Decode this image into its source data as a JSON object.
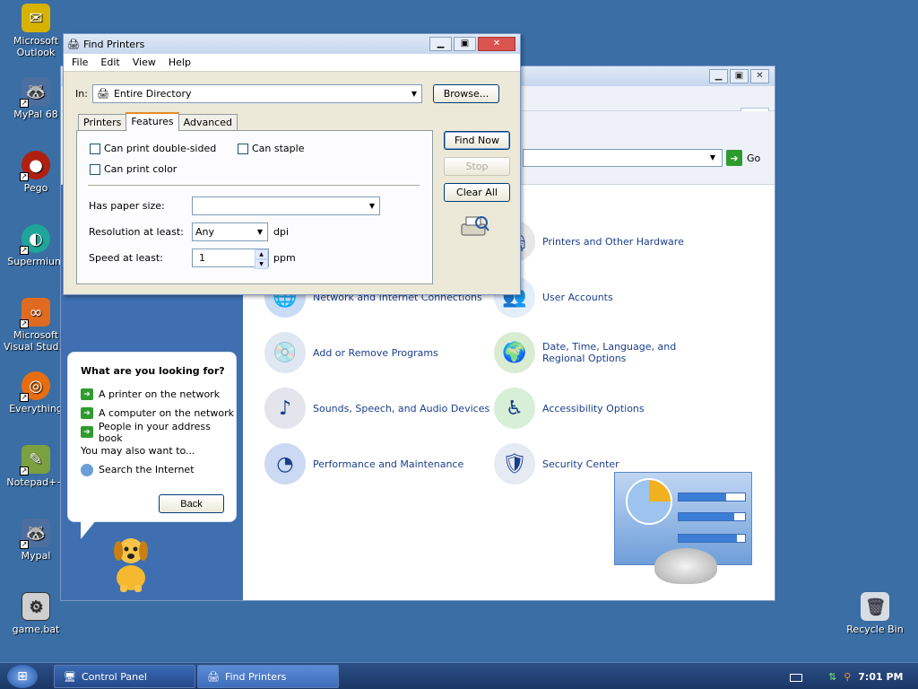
{
  "desktop": {
    "icons": [
      {
        "label": "Microsoft Outlook",
        "glyph": "✉",
        "color": "#d7b200"
      },
      {
        "label": "MyPal 68",
        "glyph": "🦝",
        "color": "#4d6fa0"
      },
      {
        "label": "Pego",
        "glyph": "●",
        "color": "#b02010"
      },
      {
        "label": "Supermium",
        "glyph": "◐",
        "color": "#1fa59a"
      },
      {
        "label": "Microsoft Visual Stud...",
        "glyph": "∞",
        "color": "#e06b20"
      },
      {
        "label": "Everything",
        "glyph": "◎",
        "color": "#e86d10"
      },
      {
        "label": "Notepad++",
        "glyph": "✎",
        "color": "#7aa040"
      },
      {
        "label": "Mypal",
        "glyph": "🦝",
        "color": "#4d6fa0"
      },
      {
        "label": "game.bat",
        "glyph": "⚙",
        "color": "#cfcfcf"
      }
    ],
    "recycle_bin": "Recycle Bin"
  },
  "control_panel": {
    "go_label": "Go",
    "items": [
      {
        "label": "Printers and Other Hardware",
        "glyph": "🖨",
        "color": "#e7e7e7"
      },
      {
        "label": "Network and Internet Connections",
        "glyph": "🌐",
        "color": "#c9dcf5"
      },
      {
        "label": "User Accounts",
        "glyph": "👥",
        "color": "#e3eef9"
      },
      {
        "label": "Add or Remove Programs",
        "glyph": "💿",
        "color": "#dfe7f3"
      },
      {
        "label": "Date, Time, Language, and Regional Options",
        "glyph": "🌍",
        "color": "#d9ecd2"
      },
      {
        "label": "Sounds, Speech, and Audio Devices",
        "glyph": "♪",
        "color": "#e4e4ec"
      },
      {
        "label": "Accessibility Options",
        "glyph": "♿",
        "color": "#d6efd6"
      },
      {
        "label": "Performance and Maintenance",
        "glyph": "◔",
        "color": "#cbdaf2"
      },
      {
        "label": "Security Center",
        "glyph": "🛡",
        "color": "#e6eaf3"
      }
    ]
  },
  "assistant": {
    "heading": "What are you looking for?",
    "links": [
      "A printer on the network",
      "A computer on the network",
      "People in your address book"
    ],
    "also": "You may also want to...",
    "search_internet": "Search the Internet",
    "back": "Back"
  },
  "find_printers": {
    "title": "Find Printers",
    "menu": [
      "File",
      "Edit",
      "View",
      "Help"
    ],
    "in_label": "In:",
    "in_value": "Entire Directory",
    "browse": "Browse...",
    "tabs": [
      "Printers",
      "Features",
      "Advanced"
    ],
    "active_tab": "Features",
    "checkboxes": [
      "Can print double-sided",
      "Can staple",
      "Can print color"
    ],
    "paper_size_label": "Has paper size:",
    "paper_size_value": "",
    "resolution_label": "Resolution at least:",
    "resolution_value": "Any",
    "resolution_unit": "dpi",
    "speed_label": "Speed at least:",
    "speed_value": "1",
    "speed_unit": "ppm",
    "find_now": "Find Now",
    "stop": "Stop",
    "clear_all": "Clear All"
  },
  "taskbar": {
    "tasks": [
      "Control Panel",
      "Find Printers"
    ],
    "clock": "7:01 PM"
  }
}
